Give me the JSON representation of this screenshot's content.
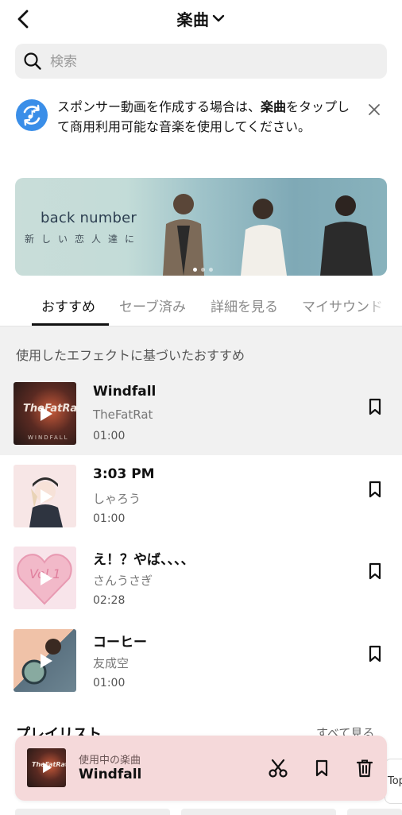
{
  "header": {
    "title": "楽曲",
    "back_icon": "chevron-left-icon",
    "title_dropdown_icon": "chevron-down-icon"
  },
  "search": {
    "placeholder": "検索",
    "icon": "search-icon"
  },
  "notice": {
    "text_before": "スポンサー動画を作成する場合は、",
    "text_bold": "楽曲",
    "text_after": "をタップして商用利用可能な音楽を使用してください。",
    "icon": "music-rotate-icon",
    "close_icon": "close-icon",
    "accent_color": "#3a8ee8"
  },
  "banner": {
    "artist": "back number",
    "song": "新しい恋人達に",
    "slide_count": 3,
    "active_slide": 1
  },
  "tabs": [
    {
      "label": "おすすめ",
      "active": true
    },
    {
      "label": "セーブ済み",
      "active": false
    },
    {
      "label": "詳細を見る",
      "active": false
    },
    {
      "label": "マイサウンド",
      "active": false
    }
  ],
  "recommend": {
    "title": "使用したエフェクトに基づいたおすすめ",
    "songs": [
      {
        "title": "Windfall",
        "artist": "TheFatRat",
        "duration": "01:00",
        "highlighted": true
      },
      {
        "title": "3:03 PM",
        "artist": "しゃろう",
        "duration": "01:00",
        "highlighted": false
      },
      {
        "title": "え！？やば、、、、",
        "artist": "さんうさぎ",
        "duration": "02:28",
        "highlighted": false
      },
      {
        "title": "コーヒー",
        "artist": "友成空",
        "duration": "01:00",
        "highlighted": false
      }
    ]
  },
  "playlists": {
    "title": "プレイリスト",
    "see_all": "すべて見る"
  },
  "now_playing": {
    "label": "使用中の楽曲",
    "title": "Windfall",
    "icons": [
      "scissors-icon",
      "bookmark-icon",
      "trash-icon"
    ],
    "background": "#f5d9da"
  },
  "peek_text": "Top"
}
